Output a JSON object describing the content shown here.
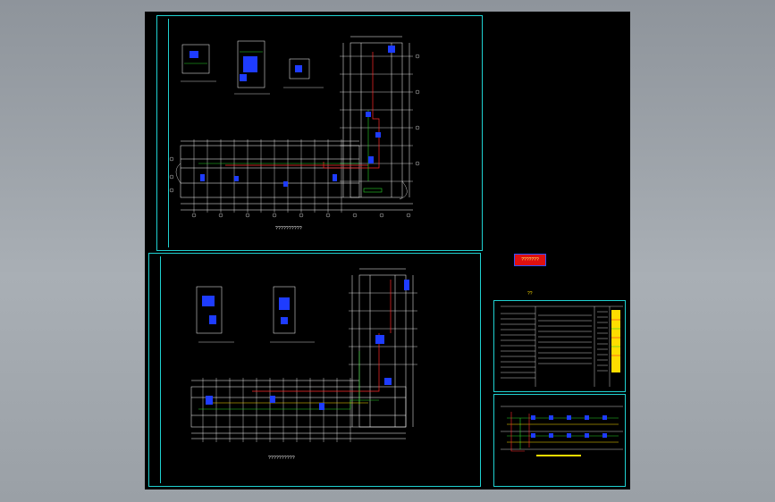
{
  "viewer": {
    "background_color": "#9ea4aa",
    "sheet_color": "#000000",
    "frame_color": "#1fd1d1"
  },
  "sheet": {
    "plan_top": {
      "caption": "??????????"
    },
    "plan_bottom": {
      "caption": "??????????"
    },
    "side_panel": {
      "red_title": "???????",
      "notes_heading": "??"
    }
  }
}
